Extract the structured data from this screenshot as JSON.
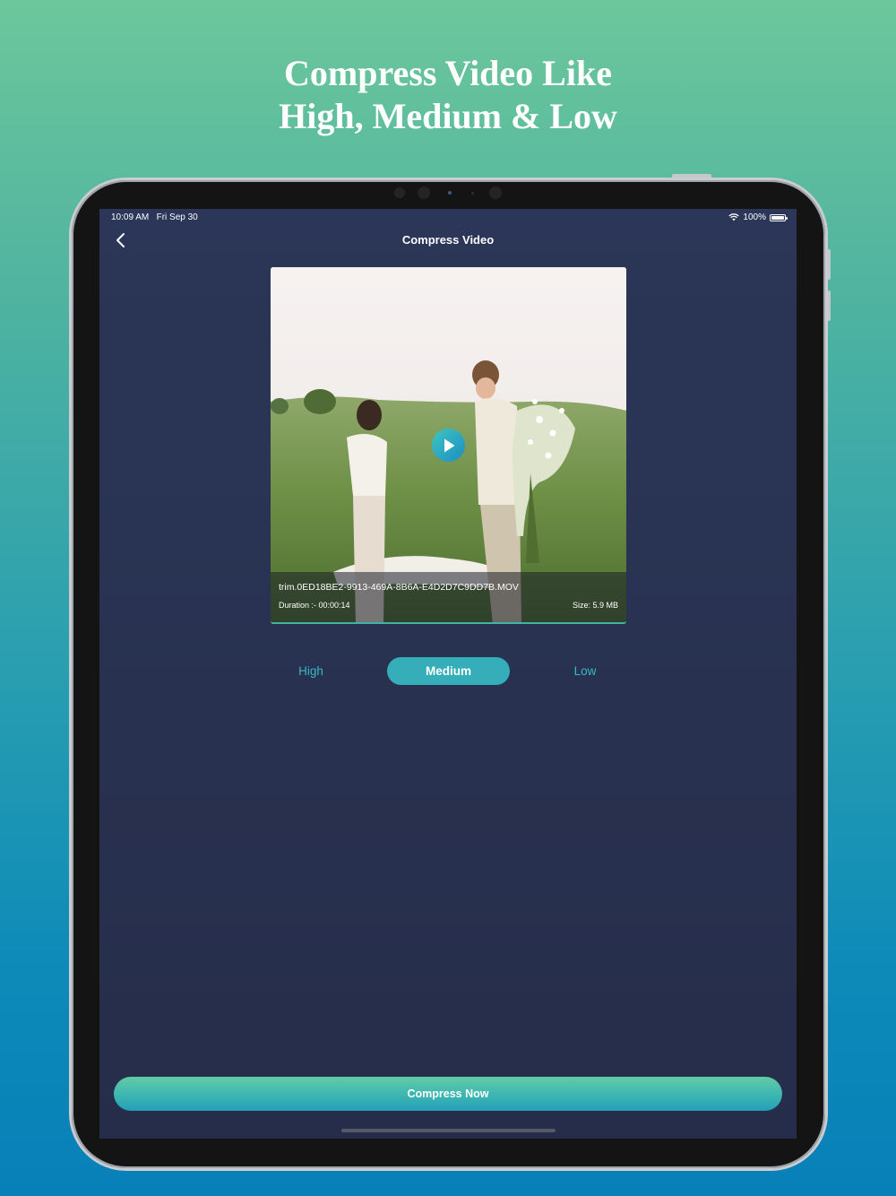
{
  "promo": {
    "headline_line1": "Compress Video Like",
    "headline_line2": "High, Medium & Low"
  },
  "status_bar": {
    "time": "10:09 AM",
    "date": "Fri Sep 30",
    "battery": "100%"
  },
  "nav": {
    "title": "Compress Video",
    "back_icon": "chevron-left-icon"
  },
  "video": {
    "filename": "trim.0ED18BE2-9913-469A-8B6A-E4D2D7C9DD7B.MOV",
    "duration": "Duration :- 00:00:14",
    "size": "Size: 5.9 MB",
    "play_icon": "play-icon"
  },
  "quality_options": {
    "high": "High",
    "medium": "Medium",
    "low": "Low",
    "selected": "Medium"
  },
  "actions": {
    "compress_label": "Compress Now"
  },
  "colors": {
    "accent": "#35aeba",
    "screen_bg": "#2a3456",
    "button_top": "#62cba5",
    "button_bottom": "#259fb8"
  }
}
